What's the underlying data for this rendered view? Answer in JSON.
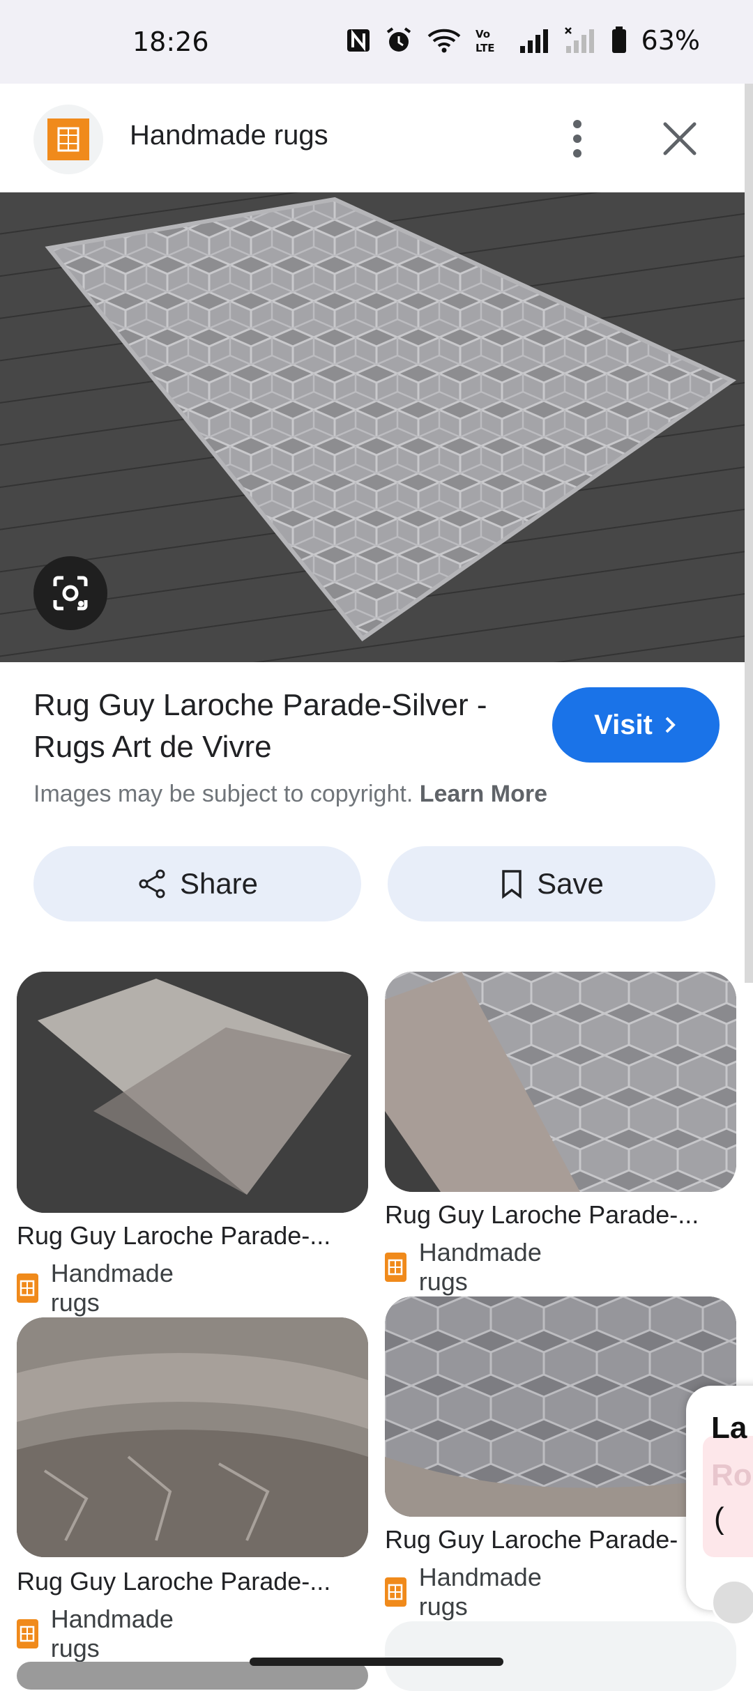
{
  "status_bar": {
    "time": "18:26",
    "battery": "63%",
    "icons": [
      "nfc-icon",
      "alarm-icon",
      "wifi-icon",
      "volte-icon",
      "signal-icon",
      "signal-2-icon",
      "battery-icon"
    ]
  },
  "header": {
    "title": "Handmade rugs",
    "logo": "handmade-rugs-logo",
    "more_icon": "more-vert-icon",
    "close_icon": "close-icon"
  },
  "main": {
    "image_alt": "Grey geometric rug on wooden floor",
    "lens_icon": "google-lens-icon",
    "result_title": "Rug Guy Laroche Parade-Silver - Rugs Art de Vivre",
    "visit_label": "Visit",
    "copyright_text": "Images may be subject to copyright.",
    "learn_more": "Learn More",
    "share_label": "Share",
    "save_label": "Save"
  },
  "related": [
    {
      "title": "Rug Guy Laroche Parade-...",
      "source": "Handmade rugs"
    },
    {
      "title": "Rug Guy Laroche Parade-...",
      "source": "Handmade rugs"
    },
    {
      "title": "Rug Guy Laroche Parade-...",
      "source": "Handmade rugs"
    },
    {
      "title": "Rug Guy Laroche Parade-",
      "source": "Handmade rugs"
    }
  ],
  "overlay": {
    "line1": "La",
    "line2": "Ro",
    "line3": "("
  },
  "colors": {
    "accent": "#1a73e8",
    "brand_orange": "#f08a1b",
    "button_bg": "#e8eef9"
  }
}
